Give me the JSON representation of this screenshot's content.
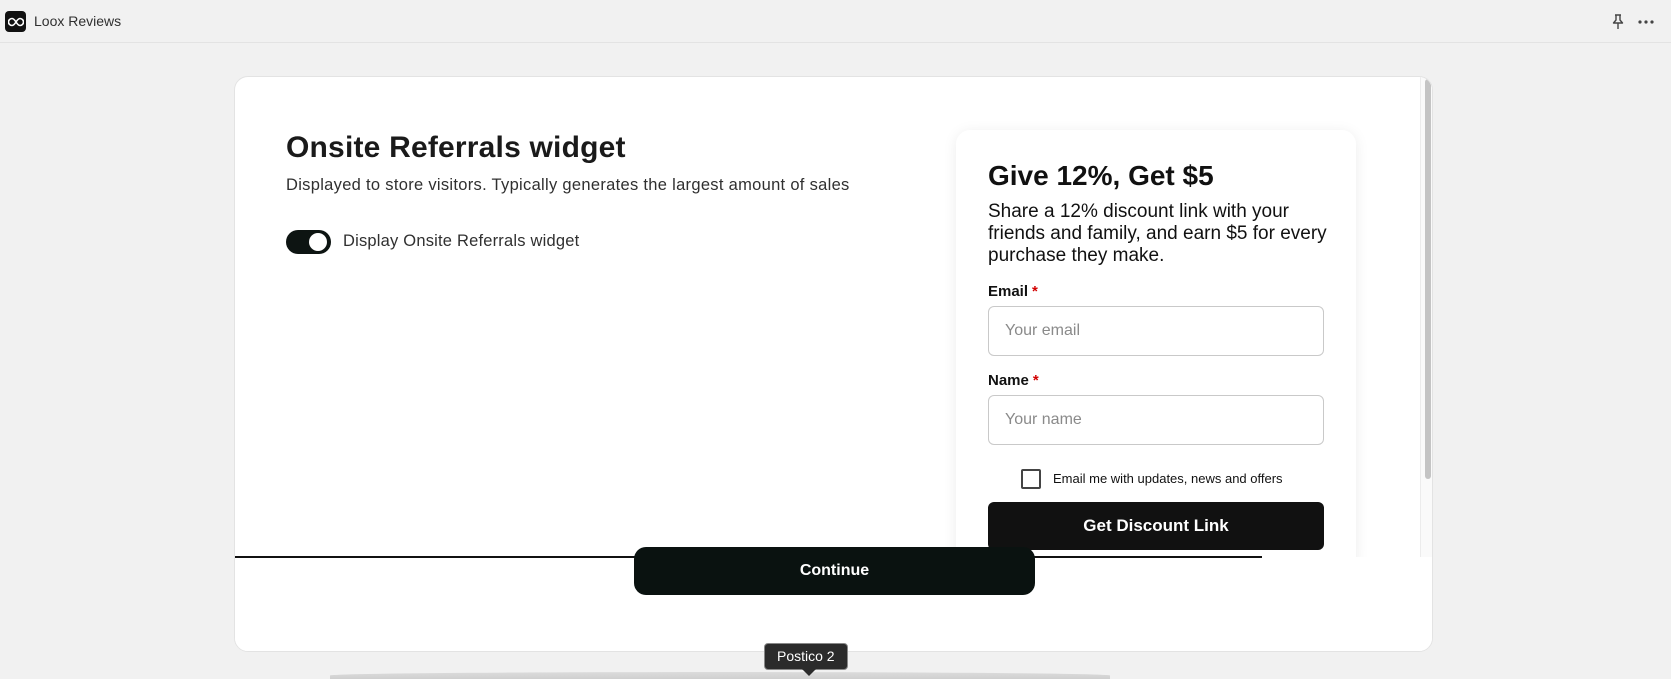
{
  "app": {
    "title": "Loox Reviews",
    "logo_icon": "infinity-logo-icon",
    "pin_icon": "pin-icon",
    "more_icon": "more-horizontal-icon"
  },
  "settings": {
    "title": "Onsite Referrals widget",
    "description": "Displayed to store visitors. Typically generates the largest amount of sales",
    "toggle_label": "Display Onsite Referrals widget",
    "toggle_on": true
  },
  "preview": {
    "title": "Give 12%, Get $5",
    "subtitle": "Share a 12% discount link with your friends and family, and earn $5 for every purchase they make.",
    "email_label": "Email",
    "email_required": "*",
    "email_placeholder": "Your email",
    "name_label": "Name",
    "name_required": "*",
    "name_placeholder": "Your name",
    "checkbox_label": "Email me with updates, news and offers",
    "button_label": "Get Discount Link"
  },
  "footer": {
    "continue_label": "Continue"
  },
  "tooltip": {
    "text": "Postico 2"
  },
  "colors": {
    "toggle_on": "#0d1412",
    "continue_bg": "#0a1210",
    "required": "#d20000"
  }
}
